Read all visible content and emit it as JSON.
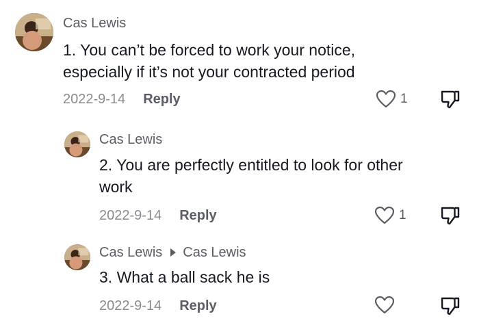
{
  "comments": [
    {
      "author": "Cas Lewis",
      "line1": "1. You can’t be forced to work your notice,",
      "line2": "especially if it’s not your contracted period",
      "date": "2022-9-14",
      "reply_label": "Reply",
      "like_count": "1"
    },
    {
      "author": "Cas Lewis",
      "line1": "2. You are perfectly entitled to look for other",
      "line2": "work",
      "date": "2022-9-14",
      "reply_label": "Reply",
      "like_count": "1"
    },
    {
      "author": "Cas Lewis",
      "reply_to": "Cas Lewis",
      "line1": "3. What a ball sack he is",
      "date": "2022-9-14",
      "reply_label": "Reply",
      "like_count": ""
    }
  ],
  "icons": {
    "like": "heart-outline-icon",
    "dislike": "thumbs-down-icon",
    "reply_arrow": "caret-right-icon"
  },
  "colors": {
    "text": "#161823",
    "secondary": "#5b5d66",
    "muted": "#8a8b91"
  }
}
